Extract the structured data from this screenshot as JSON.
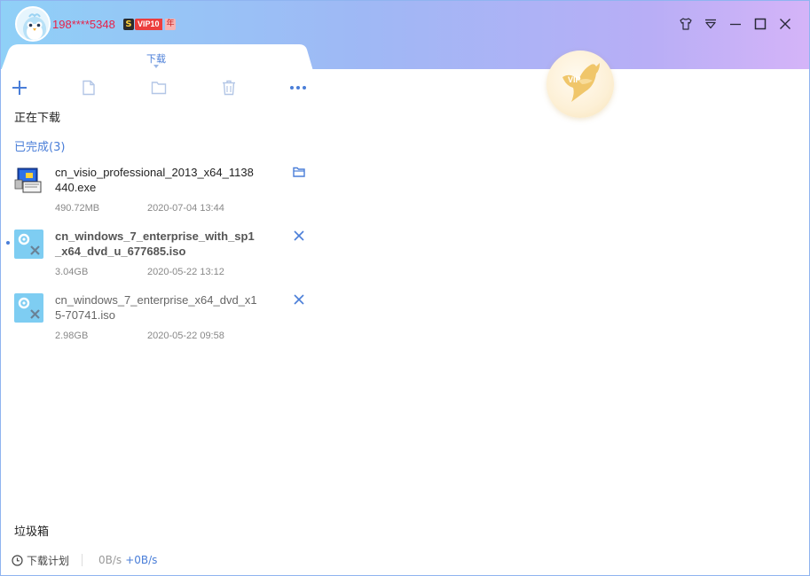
{
  "header": {
    "username": "198****5348",
    "badge_s": "S",
    "badge_vip": "VIP10",
    "badge_year": "年",
    "vip_emblem_text": "VIP"
  },
  "window_controls": [
    "skin-icon",
    "dropdown-icon",
    "minimize-icon",
    "maximize-icon",
    "close-icon"
  ],
  "tab": {
    "label": "下载"
  },
  "toolbar": [
    "add-icon",
    "new-file-icon",
    "folder-icon",
    "delete-icon",
    "more-icon"
  ],
  "sections": {
    "downloading": "正在下载",
    "completed": "已完成(3)"
  },
  "files": [
    {
      "name": "cn_visio_professional_2013_x64_1138440.exe",
      "size": "490.72MB",
      "date": "2020-07-04 13:44",
      "icon": "installer-icon",
      "action": "open-folder-icon"
    },
    {
      "name": "cn_windows_7_enterprise_with_sp1_x64_dvd_u_677685.iso",
      "size": "3.04GB",
      "date": "2020-05-22 13:12",
      "icon": "iso-file-icon",
      "action": "remove-icon"
    },
    {
      "name": "cn_windows_7_enterprise_x64_dvd_x15-70741.iso",
      "size": "2.98GB",
      "date": "2020-05-22 09:58",
      "icon": "iso-file-icon",
      "action": "remove-icon"
    }
  ],
  "footer": {
    "trash": "垃圾箱",
    "schedule": "下载计划",
    "down_speed": "0B/s",
    "up_speed": "+0B/s"
  },
  "colors": {
    "accent": "#4a7ed8",
    "username": "#e8224a",
    "vip_red": "#ec3e3e"
  }
}
